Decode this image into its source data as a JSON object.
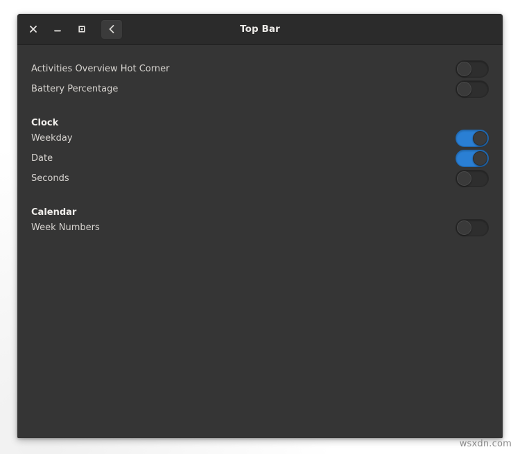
{
  "window": {
    "title": "Top Bar",
    "controls": {
      "close_label": "Close",
      "minimize_label": "Minimize",
      "maximize_label": "Maximize",
      "back_label": "Back"
    }
  },
  "colors": {
    "window_bg": "#353535",
    "headerbar_bg": "#2b2b2b",
    "accent_blue": "#2a7fd4",
    "toggle_off_bg": "#2e2e2e",
    "text": "#d6d3cf",
    "heading_text": "#efedea"
  },
  "content": {
    "blocks": [
      {
        "type": "rows",
        "rows": [
          {
            "label": "Activities Overview Hot Corner",
            "state": "off"
          },
          {
            "label": "Battery Percentage",
            "state": "off"
          }
        ]
      },
      {
        "type": "section",
        "title": "Clock",
        "rows": [
          {
            "label": "Weekday",
            "state": "on"
          },
          {
            "label": "Date",
            "state": "on"
          },
          {
            "label": "Seconds",
            "state": "off"
          }
        ]
      },
      {
        "type": "section",
        "title": "Calendar",
        "rows": [
          {
            "label": "Week Numbers",
            "state": "off"
          }
        ]
      }
    ]
  },
  "watermark": {
    "text": "wsxdn.com"
  }
}
